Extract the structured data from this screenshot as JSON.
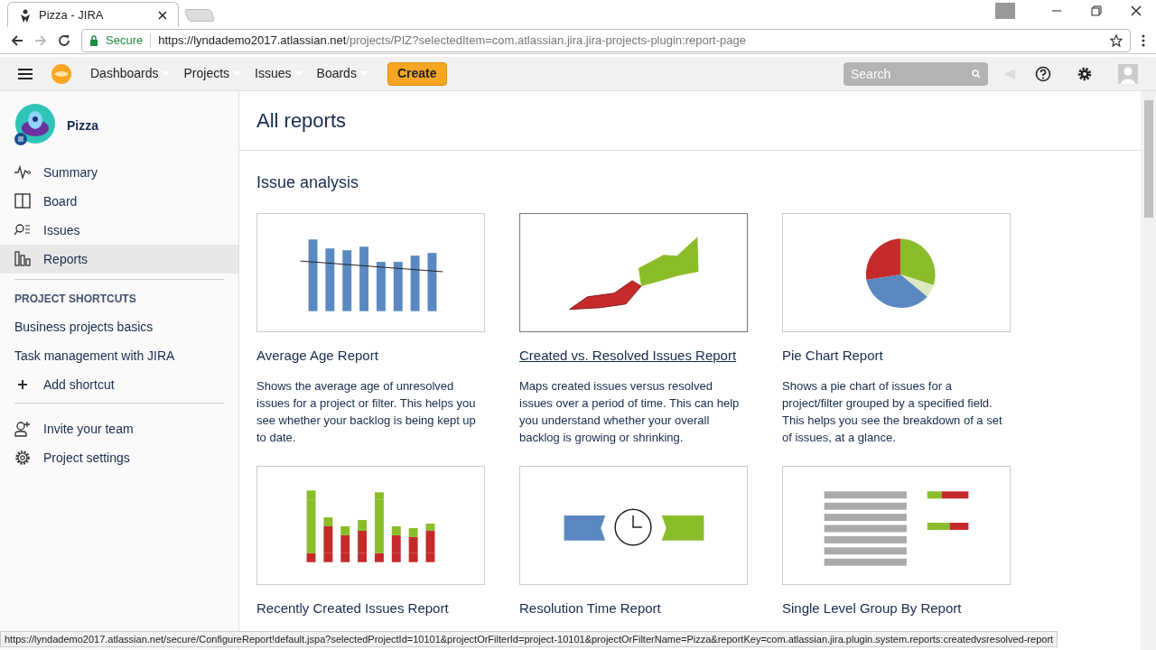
{
  "browser": {
    "tab_title": "Pizza - JIRA",
    "secure_label": "Secure",
    "url_host": "https://lyndademo2017.atlassian.net",
    "url_path": "/projects/PIZ?selectedItem=com.atlassian.jira.jira-projects-plugin:report-page"
  },
  "nav": {
    "items": [
      "Dashboards",
      "Projects",
      "Issues",
      "Boards"
    ],
    "create": "Create",
    "search": {
      "placeholder": "Search"
    }
  },
  "sidebar": {
    "project": "Pizza",
    "items": [
      {
        "kind": "summary",
        "label": "Summary",
        "selected": false
      },
      {
        "kind": "board",
        "label": "Board",
        "selected": false
      },
      {
        "kind": "issues",
        "label": "Issues",
        "selected": false
      },
      {
        "kind": "reports",
        "label": "Reports",
        "selected": true
      }
    ],
    "shortcuts_heading": "PROJECT SHORTCUTS",
    "shortcuts": [
      "Business projects basics",
      "Task management with JIRA"
    ],
    "add_shortcut": "Add shortcut",
    "footer_items": [
      {
        "kind": "invite",
        "label": "Invite your team"
      },
      {
        "kind": "settings",
        "label": "Project settings"
      }
    ]
  },
  "page_title": "All reports",
  "section_title": "Issue analysis",
  "reports": [
    {
      "kind": "average-age",
      "title": "Average Age Report",
      "hovered": false,
      "description": "Shows the average age of unresolved issues for a project or filter. This helps you see whether your backlog is being kept up to date."
    },
    {
      "kind": "created-resolved",
      "title": "Created vs. Resolved Issues Report",
      "hovered": true,
      "description": "Maps created issues versus resolved issues over a period of time. This can help you understand whether your overall backlog is growing or shrinking."
    },
    {
      "kind": "pie",
      "title": "Pie Chart Report",
      "hovered": false,
      "description": "Shows a pie chart of issues for a project/filter grouped by a specified field. This helps you see the breakdown of a set of issues, at a glance."
    },
    {
      "kind": "recently-created",
      "title": "Recently Created Issues Report",
      "hovered": false
    },
    {
      "kind": "resolution-time",
      "title": "Resolution Time Report",
      "hovered": false
    },
    {
      "kind": "group-by",
      "title": "Single Level Group By Report",
      "hovered": false
    }
  ],
  "status_url": "https://lyndademo2017.atlassian.net/secure/ConfigureReport!default.jspa?selectedProjectId=10101&projectOrFilterId=project-10101&projectOrFilterName=Pizza&reportKey=com.atlassian.jira.plugin.system.reports:createdvsresolved-report"
}
